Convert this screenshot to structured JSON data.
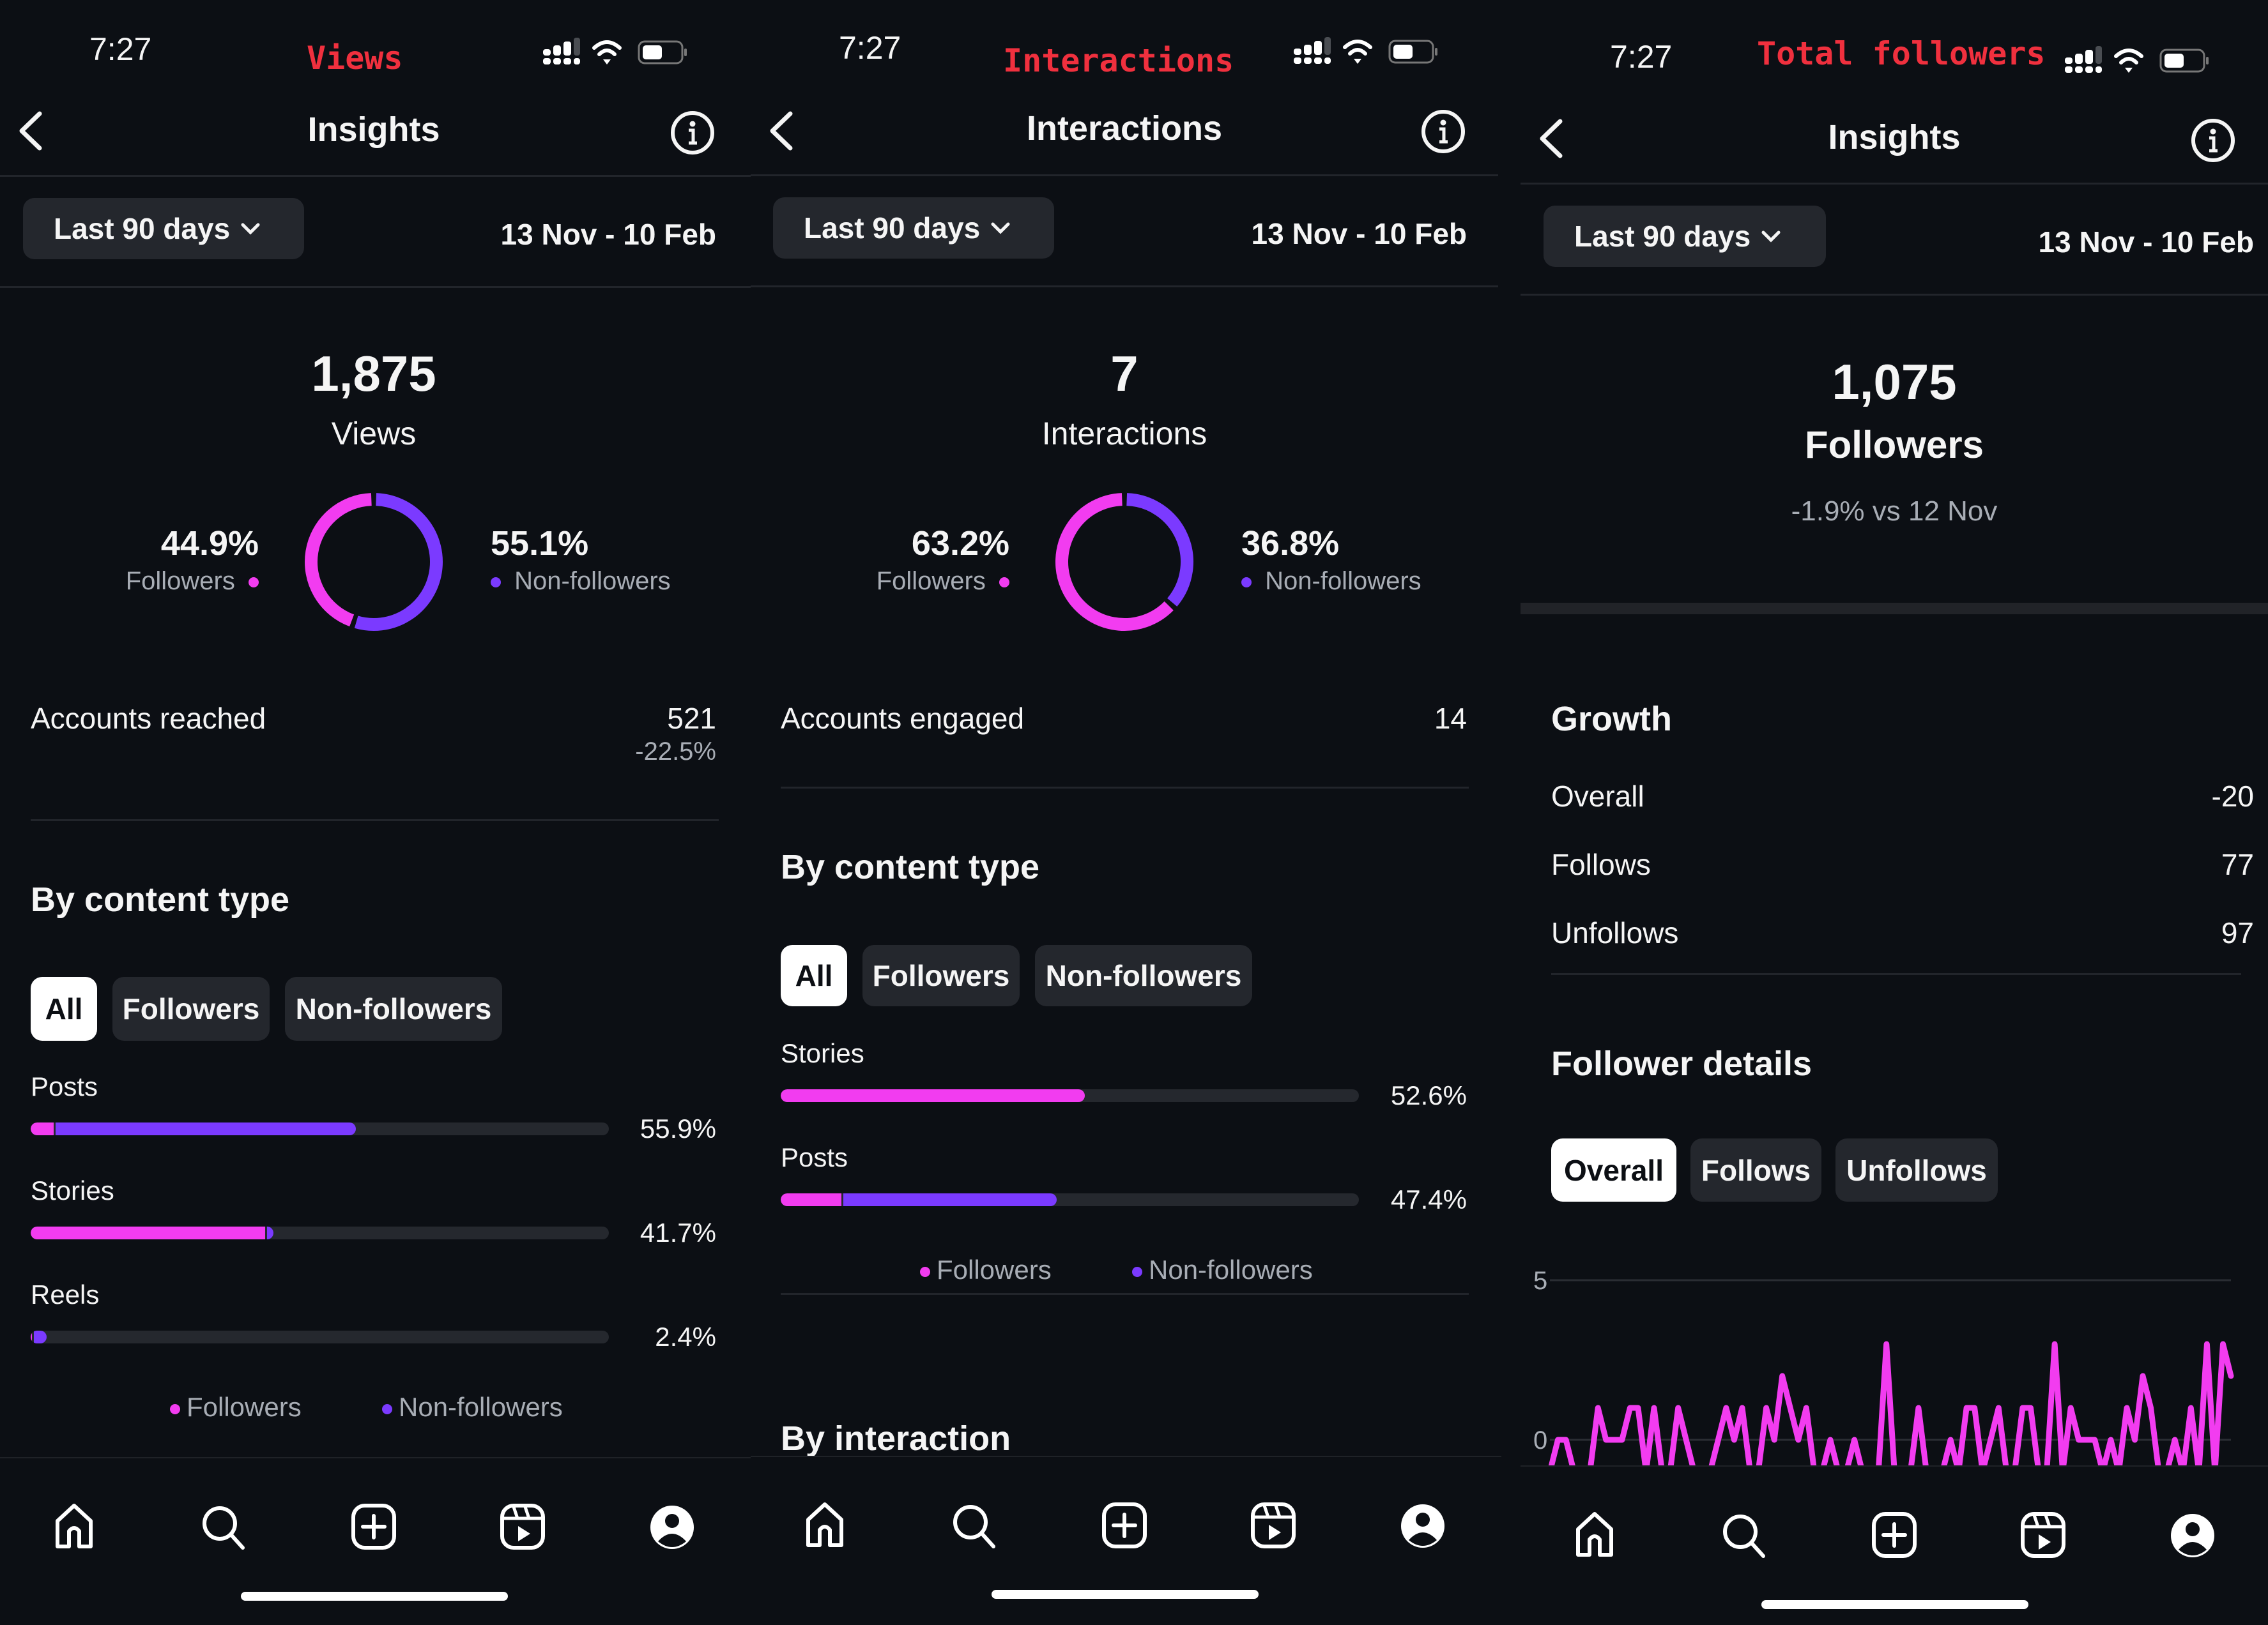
{
  "colors": {
    "background": "#0c0f14",
    "followers": "#f23cf0",
    "non_followers": "#7b3aff",
    "annotation": "#f0303e",
    "track": "#25282e",
    "pill": "#24272d"
  },
  "panels": [
    {
      "status": {
        "time": "7:27",
        "annotation": "Views"
      },
      "header": {
        "title": "Insights",
        "back_icon": "chevron-left-icon",
        "info_icon": "info-icon"
      },
      "filter": {
        "range_label": "Last 90 days",
        "date_range": "13 Nov - 10 Feb"
      },
      "summary": {
        "value": "1,875",
        "label": "Views"
      },
      "donut": {
        "followers": {
          "pct_label": "44.9%",
          "label": "Followers",
          "value": 44.9
        },
        "non_followers": {
          "pct_label": "55.1%",
          "label": "Non-followers",
          "value": 55.1
        }
      },
      "metric": {
        "label": "Accounts reached",
        "value": "521",
        "change": "-22.5%"
      },
      "content_type": {
        "title": "By content type",
        "tabs": [
          "All",
          "Followers",
          "Non-followers"
        ],
        "active_tab": 0,
        "bars": [
          {
            "label": "Posts",
            "pct_label": "55.9%",
            "followers": 4.0,
            "non_followers": 51.9
          },
          {
            "label": "Stories",
            "pct_label": "41.7%",
            "followers": 40.5,
            "non_followers": 1.2
          },
          {
            "label": "Reels",
            "pct_label": "2.4%",
            "followers": 0.2,
            "non_followers": 2.2
          }
        ],
        "legend": [
          "Followers",
          "Non-followers"
        ]
      }
    },
    {
      "status": {
        "time": "7:27",
        "annotation": "Interactions"
      },
      "header": {
        "title": "Interactions",
        "back_icon": "chevron-left-icon",
        "info_icon": "info-icon"
      },
      "filter": {
        "range_label": "Last 90 days",
        "date_range": "13 Nov - 10 Feb"
      },
      "summary": {
        "value": "7",
        "label": "Interactions"
      },
      "donut": {
        "followers": {
          "pct_label": "63.2%",
          "label": "Followers",
          "value": 63.2
        },
        "non_followers": {
          "pct_label": "36.8%",
          "label": "Non-followers",
          "value": 36.8
        }
      },
      "metric": {
        "label": "Accounts engaged",
        "value": "14"
      },
      "content_type": {
        "title": "By content type",
        "tabs": [
          "All",
          "Followers",
          "Non-followers"
        ],
        "active_tab": 0,
        "bars": [
          {
            "label": "Stories",
            "pct_label": "52.6%",
            "followers": 52.6,
            "non_followers": 0
          },
          {
            "label": "Posts",
            "pct_label": "47.4%",
            "followers": 10.5,
            "non_followers": 36.9
          }
        ],
        "legend": [
          "Followers",
          "Non-followers"
        ]
      },
      "next_section": "By interaction"
    },
    {
      "status": {
        "time": "7:27",
        "annotation": "Total followers"
      },
      "header": {
        "title": "Insights",
        "back_icon": "chevron-left-icon",
        "info_icon": "info-icon"
      },
      "filter": {
        "range_label": "Last 90 days",
        "date_range": "13 Nov - 10 Feb"
      },
      "summary": {
        "value": "1,075",
        "label": "Followers",
        "change": "-1.9% vs 12 Nov"
      },
      "growth": {
        "title": "Growth",
        "rows": [
          {
            "label": "Overall",
            "value": "-20"
          },
          {
            "label": "Follows",
            "value": "77"
          },
          {
            "label": "Unfollows",
            "value": "97"
          }
        ]
      },
      "follower_details": {
        "title": "Follower details",
        "tabs": [
          "Overall",
          "Follows",
          "Unfollows"
        ],
        "active_tab": 0
      }
    }
  ],
  "tab_bar": {
    "items": [
      {
        "name": "home",
        "icon": "home-icon"
      },
      {
        "name": "search",
        "icon": "search-icon"
      },
      {
        "name": "create",
        "icon": "plus-square-icon"
      },
      {
        "name": "reels",
        "icon": "reels-icon"
      },
      {
        "name": "profile",
        "icon": "profile-icon"
      }
    ]
  },
  "chart_data": {
    "type": "line",
    "title": "Follower details - Overall",
    "xlabel": "",
    "ylabel": "",
    "y_ticks": [
      "5",
      "0"
    ],
    "ylim": [
      -1,
      5
    ],
    "grid": true,
    "series": [
      {
        "name": "Overall",
        "color": "#f23cf0",
        "values": [
          -1,
          0,
          0,
          -1,
          -1,
          -1,
          1,
          0,
          0,
          0,
          1,
          1,
          -1,
          1,
          -1,
          -1,
          1,
          0,
          -1,
          -1,
          -1,
          0,
          1,
          0,
          1,
          -1,
          -1,
          1,
          0,
          2,
          1,
          0,
          1,
          -1,
          -1,
          0,
          -1,
          -1,
          0,
          -1,
          -1,
          -1,
          3,
          -1,
          -1,
          -1,
          1,
          -1,
          -1,
          -1,
          0,
          -1,
          1,
          1,
          -1,
          0,
          1,
          -1,
          -1,
          1,
          1,
          -1,
          -1,
          3,
          -1,
          1,
          0,
          0,
          0,
          -1,
          0,
          -1,
          1,
          0,
          2,
          1,
          -1,
          -1,
          0,
          -1,
          1,
          -1,
          3,
          -1,
          3,
          2
        ]
      }
    ]
  }
}
